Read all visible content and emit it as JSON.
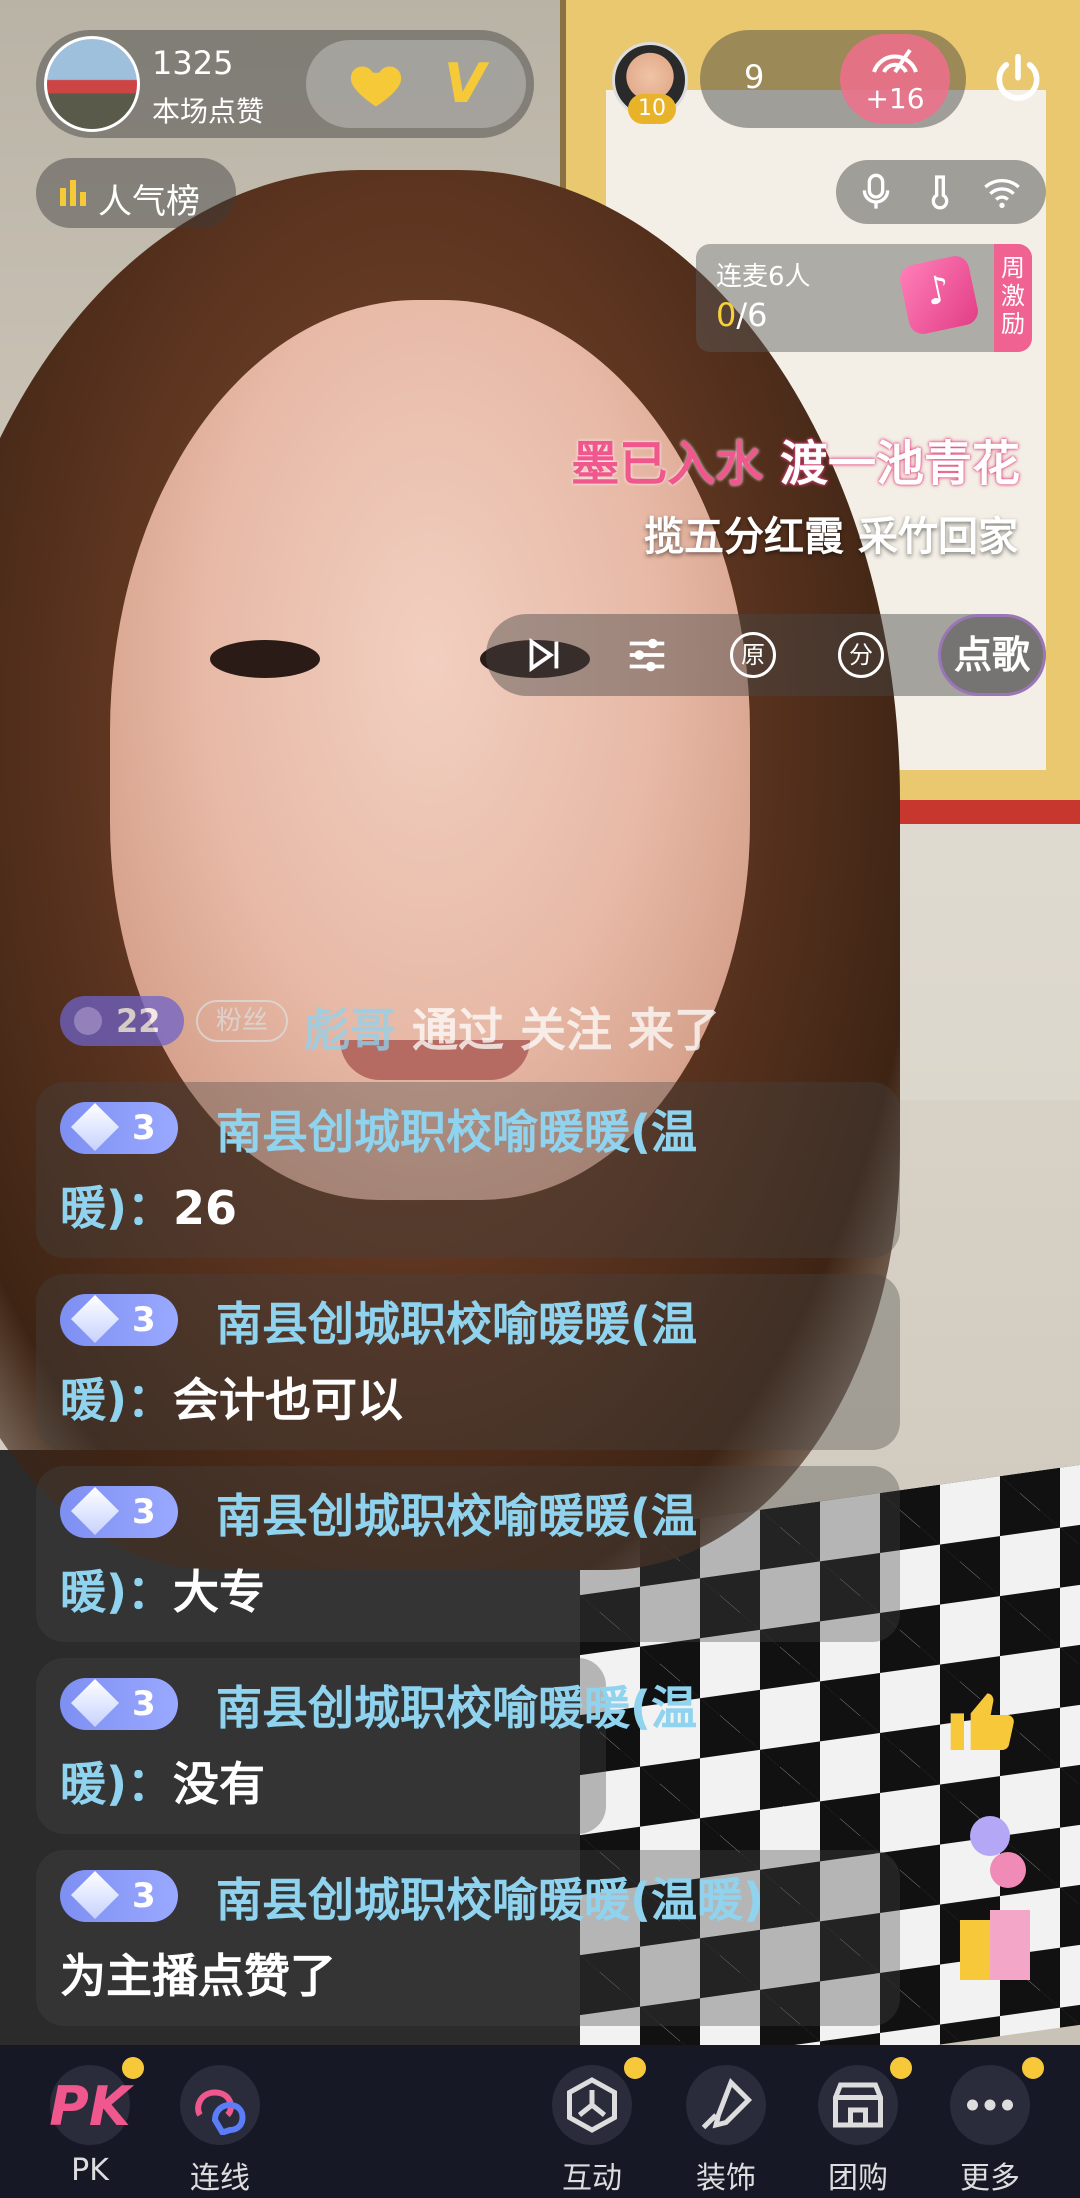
{
  "host": {
    "like_count": "1325",
    "like_label": "本场点赞"
  },
  "viewers": {
    "avatar_badge": "10",
    "count": "9",
    "plus": "+16"
  },
  "rank": {
    "label": "人气榜"
  },
  "link_card": {
    "title": "连麦6人",
    "current": "0",
    "total": "/6",
    "weekly": "周激励"
  },
  "lyrics": {
    "line1_part1": "墨已入水 ",
    "line1_part2": "渡一池青花",
    "line2": "揽五分红霞 采竹回家"
  },
  "music_bar": {
    "original_label": "原",
    "score_label": "分",
    "song_button": "点歌"
  },
  "join_notice": {
    "level": "22",
    "fan_tag": "粉丝",
    "user": "彪哥",
    "action": "通过 关注 来了"
  },
  "messages": [
    {
      "level": "3",
      "name_line1": "南县创城职校喻暖暖(温",
      "name_line2": "暖)：",
      "text": "26"
    },
    {
      "level": "3",
      "name_line1": "南县创城职校喻暖暖(温",
      "name_line2": "暖)：",
      "text": "会计也可以"
    },
    {
      "level": "3",
      "name_line1": "南县创城职校喻暖暖(温",
      "name_line2": "暖)：",
      "text": "大专"
    },
    {
      "level": "3",
      "name_line1": "南县创城职校喻暖暖(温",
      "name_line2": "暖)：",
      "text": "没有"
    },
    {
      "level": "3",
      "name_line1": "南县创城职校喻暖暖(温暖)",
      "text": "为主播点赞了"
    }
  ],
  "toolbar": [
    {
      "label": "PK",
      "icon": "pk-icon"
    },
    {
      "label": "连线",
      "icon": "link-chat-icon"
    },
    {
      "label": "互动",
      "icon": "interact-icon"
    },
    {
      "label": "装饰",
      "icon": "decorate-icon"
    },
    {
      "label": "团购",
      "icon": "group-buy-icon"
    },
    {
      "label": "更多",
      "icon": "more-icon"
    }
  ],
  "colors": {
    "accent_pink": "#f0588d",
    "name_blue": "#8fd3ef",
    "badge_yellow": "#f7c93a",
    "toolbar_bg": "#171826"
  }
}
